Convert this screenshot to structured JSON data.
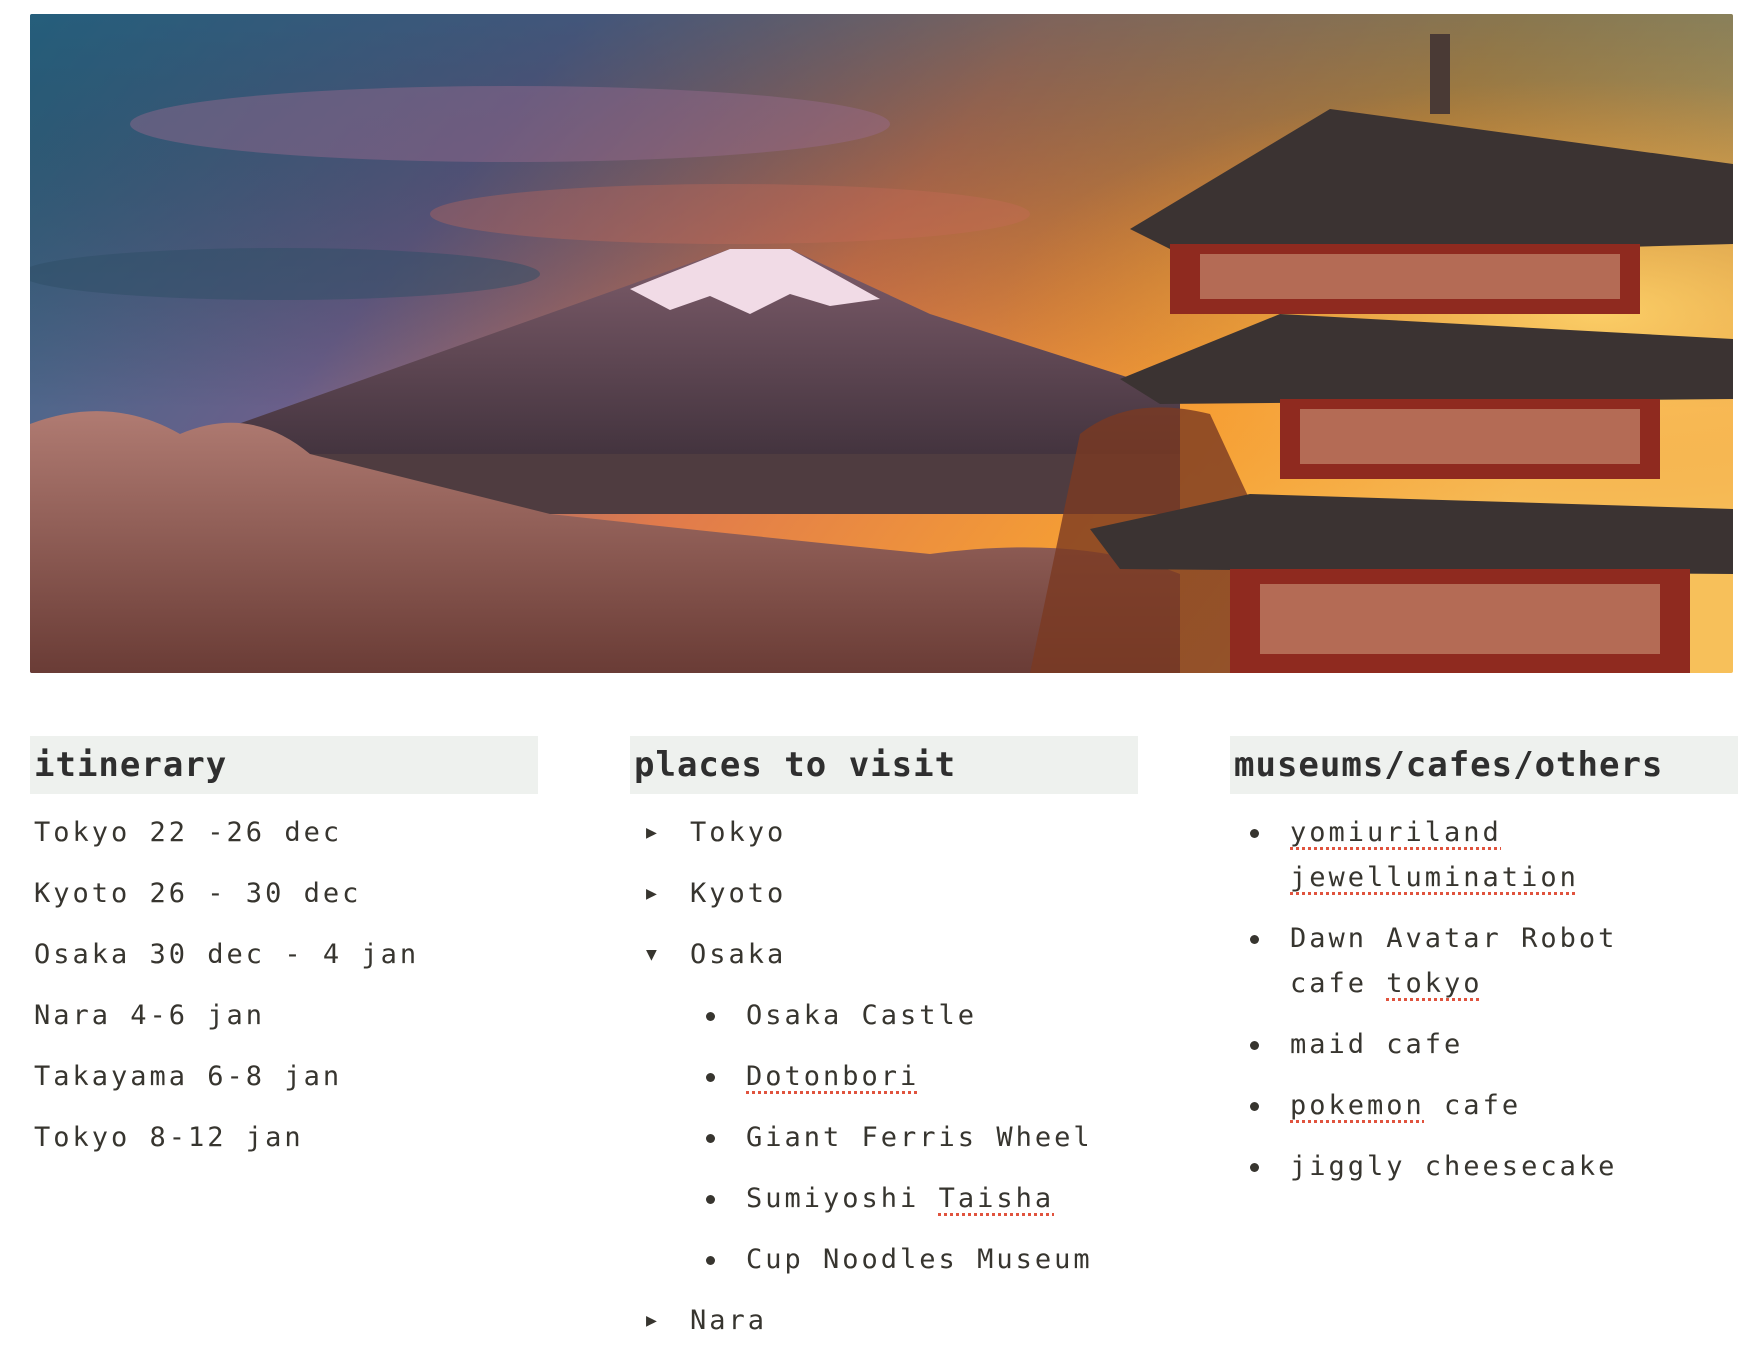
{
  "cover": {
    "description_icon": "fuji-pagoda-sunset-image"
  },
  "itinerary": {
    "heading": "itinerary",
    "lines": [
      "Tokyo 22 -26 dec",
      "Kyoto 26 - 30 dec",
      "Osaka 30 dec - 4 jan",
      "Nara 4-6 jan",
      "Takayama 6-8 jan",
      "Tokyo 8-12 jan"
    ]
  },
  "places": {
    "heading": "places to visit",
    "toggles": [
      {
        "label": "Tokyo",
        "open": false
      },
      {
        "label": "Kyoto",
        "open": false
      },
      {
        "label": "Osaka",
        "open": true
      },
      {
        "label": "Nara",
        "open": false
      }
    ],
    "osaka_items": [
      "Osaka Castle",
      "Dotonbori",
      "Giant Ferris Wheel",
      "Sumiyoshi ",
      "Taisha",
      "Cup Noodles Museum"
    ],
    "arrow_closed": "▶",
    "arrow_open": "▼"
  },
  "others": {
    "heading": "museums/cafes/others",
    "items": [
      {
        "a": "yomiuriland jewellumination"
      },
      {
        "a": "Dawn Avatar Robot cafe ",
        "b": "tokyo"
      },
      {
        "a": "maid cafe"
      },
      {
        "a": "pokemon",
        "b": " cafe"
      },
      {
        "a": "jiggly cheesecake"
      }
    ]
  },
  "colors": {
    "heading_bg": "#eef1ee",
    "text": "#37352f",
    "spellcheck": "#e0533e"
  }
}
